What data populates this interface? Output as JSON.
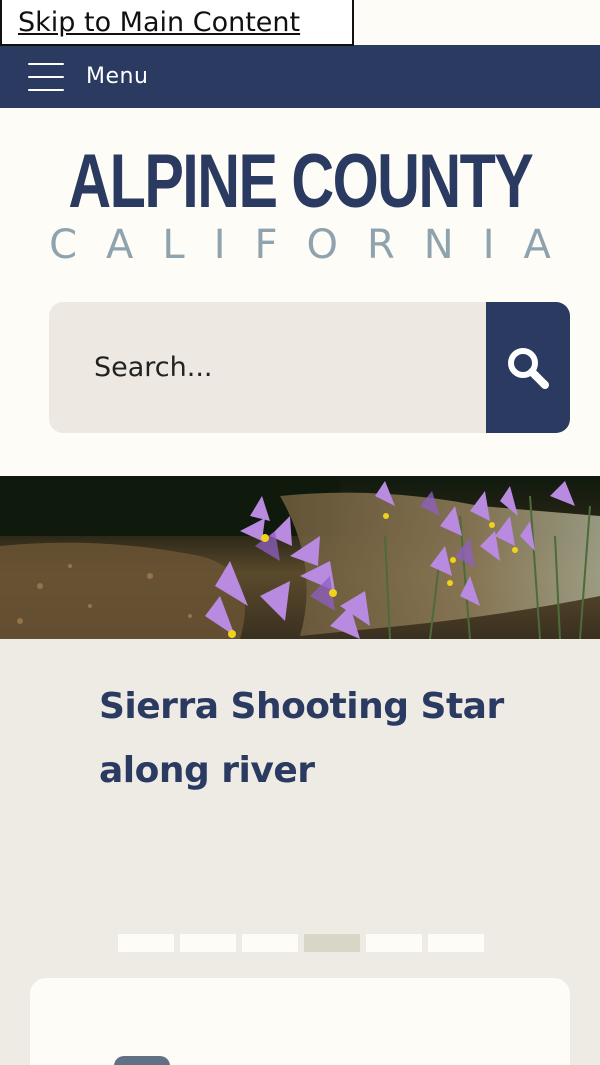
{
  "skip_link": "Skip to Main Content",
  "topbar": {
    "menu_label": "Menu"
  },
  "logo": {
    "title": "ALPINE COUNTY",
    "subtitle": "CALIFORNIA"
  },
  "search": {
    "placeholder": "Search..."
  },
  "hero": {
    "caption": "Sierra Shooting Star along river"
  },
  "slideshow": {
    "total_slides": 6,
    "active_slide": 4
  },
  "colors": {
    "navy": "#2a3a60",
    "cream": "#fdfcf7",
    "beige": "#eeebe4",
    "logo_gray": "#8fa3ae"
  }
}
